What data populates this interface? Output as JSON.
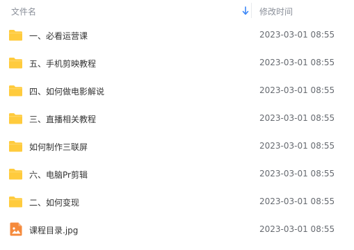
{
  "header": {
    "name_label": "文件名",
    "time_label": "修改时间",
    "sort_icon": "arrow-down-icon"
  },
  "colors": {
    "folder": "#FFCB3D",
    "image_file": "#F58A3C",
    "header_text": "#8A8F99",
    "name_text": "#333333",
    "time_text": "#666A70"
  },
  "files": [
    {
      "name": "一、必看运营课",
      "modified": "2023-03-01 08:55",
      "type": "folder",
      "icon": "folder-icon"
    },
    {
      "name": "五、手机剪映教程",
      "modified": "2023-03-01 08:55",
      "type": "folder",
      "icon": "folder-icon"
    },
    {
      "name": "四、如何做电影解说",
      "modified": "2023-03-01 08:55",
      "type": "folder",
      "icon": "folder-icon"
    },
    {
      "name": "三、直播相关教程",
      "modified": "2023-03-01 08:55",
      "type": "folder",
      "icon": "folder-icon"
    },
    {
      "name": "如何制作三联屏",
      "modified": "2023-03-01 08:55",
      "type": "folder",
      "icon": "folder-icon"
    },
    {
      "name": "六、电脑Pr剪辑",
      "modified": "2023-03-01 08:55",
      "type": "folder",
      "icon": "folder-icon"
    },
    {
      "name": "二、如何变现",
      "modified": "2023-03-01 08:55",
      "type": "folder",
      "icon": "folder-icon"
    },
    {
      "name": "课程目录.jpg",
      "modified": "2023-03-01 08:55",
      "type": "image",
      "icon": "image-file-icon"
    }
  ]
}
